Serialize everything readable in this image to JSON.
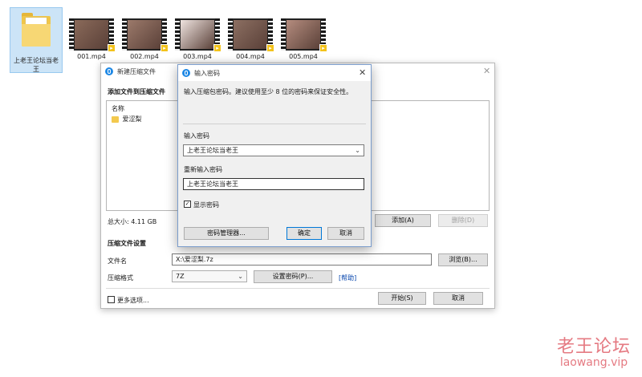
{
  "desktop": {
    "folder_label": "上老王论坛当老王",
    "videos": [
      {
        "label": "001.mp4",
        "tint": "#8a6a5a"
      },
      {
        "label": "002.mp4",
        "tint": "#9c7a6b"
      },
      {
        "label": "003.mp4",
        "tint": "#efe4e0"
      },
      {
        "label": "004.mp4",
        "tint": "#8c6f62"
      },
      {
        "label": "005.mp4",
        "tint": "#b58d7f"
      }
    ]
  },
  "archive_dialog": {
    "title": "新建压缩文件",
    "section_add": "添加文件到压缩文件",
    "list_header": "名称",
    "list_item": "爱涩梨",
    "total_size": "总大小: 4.11 GB",
    "add_button": "添加(A)",
    "delete_button": "删除(D)",
    "section_settings": "压缩文件设置",
    "filename_label": "文件名",
    "filename_value": "X:\\爱涩梨.7z",
    "browse_button": "浏览(B)...",
    "format_label": "压缩格式",
    "format_value": "7Z",
    "set_password_button": "设置密码(P)...",
    "help_link": "[帮助]",
    "more_options": "更多选项...",
    "start_button": "开始(S)",
    "cancel_button": "取消"
  },
  "password_dialog": {
    "title": "输入密码",
    "instruction": "输入压缩包密码。建议使用至少 8 位的密码来保证安全性。",
    "password_label": "输入密码",
    "password_value": "上老王论坛当老王",
    "reenter_label": "重新输入密码",
    "reenter_value": "上老王论坛当老王",
    "show_password_label": "显示密码",
    "show_password_checked": true,
    "manager_button": "密码管理器...",
    "ok_button": "确定",
    "cancel_button": "取消"
  },
  "watermark": {
    "cn": "老王论坛",
    "en": "laowang.vip"
  }
}
